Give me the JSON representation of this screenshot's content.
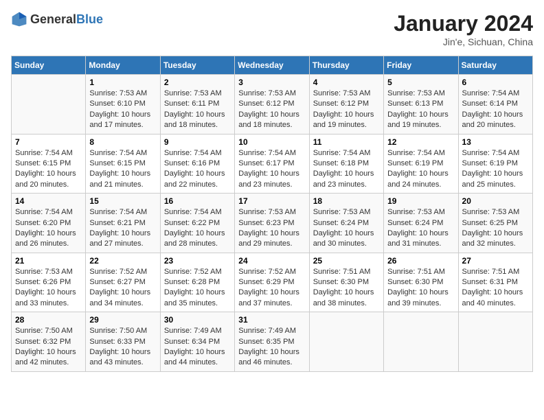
{
  "header": {
    "logo_general": "General",
    "logo_blue": "Blue",
    "month_year": "January 2024",
    "location": "Jin'e, Sichuan, China"
  },
  "days_of_week": [
    "Sunday",
    "Monday",
    "Tuesday",
    "Wednesday",
    "Thursday",
    "Friday",
    "Saturday"
  ],
  "weeks": [
    [
      {
        "day": "",
        "sunrise": "",
        "sunset": "",
        "daylight": ""
      },
      {
        "day": "1",
        "sunrise": "Sunrise: 7:53 AM",
        "sunset": "Sunset: 6:10 PM",
        "daylight": "Daylight: 10 hours and 17 minutes."
      },
      {
        "day": "2",
        "sunrise": "Sunrise: 7:53 AM",
        "sunset": "Sunset: 6:11 PM",
        "daylight": "Daylight: 10 hours and 18 minutes."
      },
      {
        "day": "3",
        "sunrise": "Sunrise: 7:53 AM",
        "sunset": "Sunset: 6:12 PM",
        "daylight": "Daylight: 10 hours and 18 minutes."
      },
      {
        "day": "4",
        "sunrise": "Sunrise: 7:53 AM",
        "sunset": "Sunset: 6:12 PM",
        "daylight": "Daylight: 10 hours and 19 minutes."
      },
      {
        "day": "5",
        "sunrise": "Sunrise: 7:53 AM",
        "sunset": "Sunset: 6:13 PM",
        "daylight": "Daylight: 10 hours and 19 minutes."
      },
      {
        "day": "6",
        "sunrise": "Sunrise: 7:54 AM",
        "sunset": "Sunset: 6:14 PM",
        "daylight": "Daylight: 10 hours and 20 minutes."
      }
    ],
    [
      {
        "day": "7",
        "sunrise": "Sunrise: 7:54 AM",
        "sunset": "Sunset: 6:15 PM",
        "daylight": "Daylight: 10 hours and 20 minutes."
      },
      {
        "day": "8",
        "sunrise": "Sunrise: 7:54 AM",
        "sunset": "Sunset: 6:15 PM",
        "daylight": "Daylight: 10 hours and 21 minutes."
      },
      {
        "day": "9",
        "sunrise": "Sunrise: 7:54 AM",
        "sunset": "Sunset: 6:16 PM",
        "daylight": "Daylight: 10 hours and 22 minutes."
      },
      {
        "day": "10",
        "sunrise": "Sunrise: 7:54 AM",
        "sunset": "Sunset: 6:17 PM",
        "daylight": "Daylight: 10 hours and 23 minutes."
      },
      {
        "day": "11",
        "sunrise": "Sunrise: 7:54 AM",
        "sunset": "Sunset: 6:18 PM",
        "daylight": "Daylight: 10 hours and 23 minutes."
      },
      {
        "day": "12",
        "sunrise": "Sunrise: 7:54 AM",
        "sunset": "Sunset: 6:19 PM",
        "daylight": "Daylight: 10 hours and 24 minutes."
      },
      {
        "day": "13",
        "sunrise": "Sunrise: 7:54 AM",
        "sunset": "Sunset: 6:19 PM",
        "daylight": "Daylight: 10 hours and 25 minutes."
      }
    ],
    [
      {
        "day": "14",
        "sunrise": "Sunrise: 7:54 AM",
        "sunset": "Sunset: 6:20 PM",
        "daylight": "Daylight: 10 hours and 26 minutes."
      },
      {
        "day": "15",
        "sunrise": "Sunrise: 7:54 AM",
        "sunset": "Sunset: 6:21 PM",
        "daylight": "Daylight: 10 hours and 27 minutes."
      },
      {
        "day": "16",
        "sunrise": "Sunrise: 7:54 AM",
        "sunset": "Sunset: 6:22 PM",
        "daylight": "Daylight: 10 hours and 28 minutes."
      },
      {
        "day": "17",
        "sunrise": "Sunrise: 7:53 AM",
        "sunset": "Sunset: 6:23 PM",
        "daylight": "Daylight: 10 hours and 29 minutes."
      },
      {
        "day": "18",
        "sunrise": "Sunrise: 7:53 AM",
        "sunset": "Sunset: 6:24 PM",
        "daylight": "Daylight: 10 hours and 30 minutes."
      },
      {
        "day": "19",
        "sunrise": "Sunrise: 7:53 AM",
        "sunset": "Sunset: 6:24 PM",
        "daylight": "Daylight: 10 hours and 31 minutes."
      },
      {
        "day": "20",
        "sunrise": "Sunrise: 7:53 AM",
        "sunset": "Sunset: 6:25 PM",
        "daylight": "Daylight: 10 hours and 32 minutes."
      }
    ],
    [
      {
        "day": "21",
        "sunrise": "Sunrise: 7:53 AM",
        "sunset": "Sunset: 6:26 PM",
        "daylight": "Daylight: 10 hours and 33 minutes."
      },
      {
        "day": "22",
        "sunrise": "Sunrise: 7:52 AM",
        "sunset": "Sunset: 6:27 PM",
        "daylight": "Daylight: 10 hours and 34 minutes."
      },
      {
        "day": "23",
        "sunrise": "Sunrise: 7:52 AM",
        "sunset": "Sunset: 6:28 PM",
        "daylight": "Daylight: 10 hours and 35 minutes."
      },
      {
        "day": "24",
        "sunrise": "Sunrise: 7:52 AM",
        "sunset": "Sunset: 6:29 PM",
        "daylight": "Daylight: 10 hours and 37 minutes."
      },
      {
        "day": "25",
        "sunrise": "Sunrise: 7:51 AM",
        "sunset": "Sunset: 6:30 PM",
        "daylight": "Daylight: 10 hours and 38 minutes."
      },
      {
        "day": "26",
        "sunrise": "Sunrise: 7:51 AM",
        "sunset": "Sunset: 6:30 PM",
        "daylight": "Daylight: 10 hours and 39 minutes."
      },
      {
        "day": "27",
        "sunrise": "Sunrise: 7:51 AM",
        "sunset": "Sunset: 6:31 PM",
        "daylight": "Daylight: 10 hours and 40 minutes."
      }
    ],
    [
      {
        "day": "28",
        "sunrise": "Sunrise: 7:50 AM",
        "sunset": "Sunset: 6:32 PM",
        "daylight": "Daylight: 10 hours and 42 minutes."
      },
      {
        "day": "29",
        "sunrise": "Sunrise: 7:50 AM",
        "sunset": "Sunset: 6:33 PM",
        "daylight": "Daylight: 10 hours and 43 minutes."
      },
      {
        "day": "30",
        "sunrise": "Sunrise: 7:49 AM",
        "sunset": "Sunset: 6:34 PM",
        "daylight": "Daylight: 10 hours and 44 minutes."
      },
      {
        "day": "31",
        "sunrise": "Sunrise: 7:49 AM",
        "sunset": "Sunset: 6:35 PM",
        "daylight": "Daylight: 10 hours and 46 minutes."
      },
      {
        "day": "",
        "sunrise": "",
        "sunset": "",
        "daylight": ""
      },
      {
        "day": "",
        "sunrise": "",
        "sunset": "",
        "daylight": ""
      },
      {
        "day": "",
        "sunrise": "",
        "sunset": "",
        "daylight": ""
      }
    ]
  ]
}
